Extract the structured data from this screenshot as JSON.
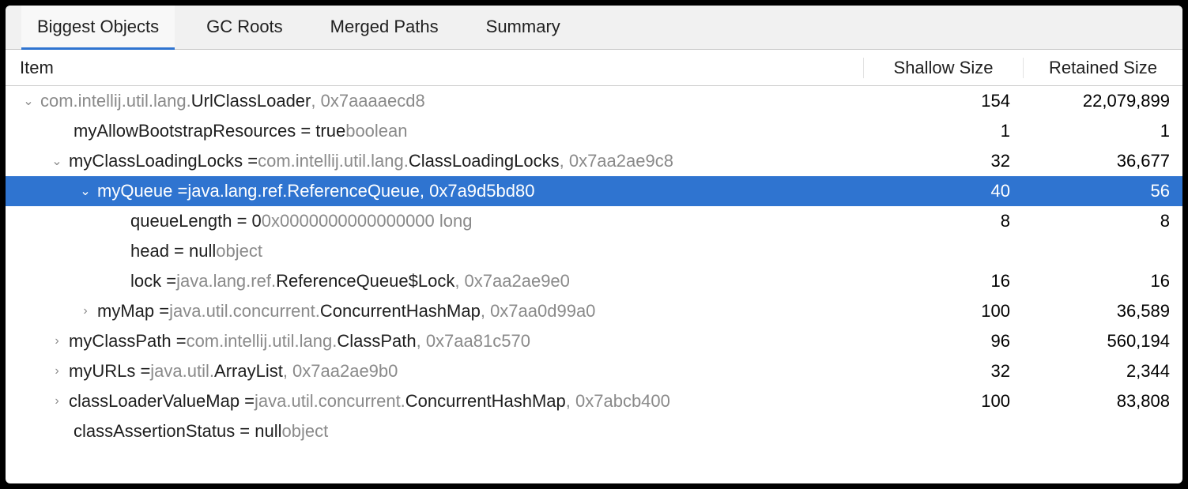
{
  "tabs": [
    {
      "label": "Biggest Objects",
      "active": true
    },
    {
      "label": "GC Roots",
      "active": false
    },
    {
      "label": "Merged Paths",
      "active": false
    },
    {
      "label": "Summary",
      "active": false
    }
  ],
  "columns": {
    "item": "Item",
    "shallow": "Shallow Size",
    "retained": "Retained Size"
  },
  "rows": [
    {
      "indent": 0,
      "chev": "down",
      "selected": false,
      "segments": [
        {
          "t": "com.intellij.util.lang.",
          "c": "pkg"
        },
        {
          "t": "UrlClassLoader",
          "c": "cls"
        },
        {
          "t": ", 0x7aaaaecd8",
          "c": "addr"
        }
      ],
      "shallow": "154",
      "retained": "22,079,899"
    },
    {
      "indent": 1,
      "chev": "",
      "selected": false,
      "segments": [
        {
          "t": "myAllowBootstrapResources = true ",
          "c": "field"
        },
        {
          "t": "boolean",
          "c": "typ"
        }
      ],
      "shallow": "1",
      "retained": "1"
    },
    {
      "indent": 1,
      "chev": "down",
      "selected": false,
      "segments": [
        {
          "t": "myClassLoadingLocks = ",
          "c": "field"
        },
        {
          "t": "com.intellij.util.lang.",
          "c": "pkg"
        },
        {
          "t": "ClassLoadingLocks",
          "c": "cls"
        },
        {
          "t": ", 0x7aa2ae9c8",
          "c": "addr"
        }
      ],
      "shallow": "32",
      "retained": "36,677"
    },
    {
      "indent": 2,
      "chev": "down",
      "selected": true,
      "segments": [
        {
          "t": "myQueue = ",
          "c": "field"
        },
        {
          "t": "java.lang.ref.",
          "c": "pkg"
        },
        {
          "t": "ReferenceQueue",
          "c": "cls"
        },
        {
          "t": ", 0x7a9d5bd80",
          "c": "addr"
        }
      ],
      "shallow": "40",
      "retained": "56"
    },
    {
      "indent": 3,
      "chev": "",
      "selected": false,
      "segments": [
        {
          "t": "queueLength = 0 ",
          "c": "field"
        },
        {
          "t": "0x0000000000000000  long",
          "c": "addr"
        }
      ],
      "shallow": "8",
      "retained": "8"
    },
    {
      "indent": 3,
      "chev": "",
      "selected": false,
      "segments": [
        {
          "t": "head = null ",
          "c": "field"
        },
        {
          "t": "object",
          "c": "typ"
        }
      ],
      "shallow": "",
      "retained": ""
    },
    {
      "indent": 3,
      "chev": "",
      "selected": false,
      "segments": [
        {
          "t": "lock = ",
          "c": "field"
        },
        {
          "t": "java.lang.ref.",
          "c": "pkg"
        },
        {
          "t": "ReferenceQueue$Lock",
          "c": "cls"
        },
        {
          "t": ", 0x7aa2ae9e0",
          "c": "addr"
        }
      ],
      "shallow": "16",
      "retained": "16"
    },
    {
      "indent": 2,
      "chev": "right",
      "selected": false,
      "segments": [
        {
          "t": "myMap = ",
          "c": "field"
        },
        {
          "t": "java.util.concurrent.",
          "c": "pkg"
        },
        {
          "t": "ConcurrentHashMap",
          "c": "cls"
        },
        {
          "t": ", 0x7aa0d99a0",
          "c": "addr"
        }
      ],
      "shallow": "100",
      "retained": "36,589"
    },
    {
      "indent": 1,
      "chev": "right",
      "selected": false,
      "segments": [
        {
          "t": "myClassPath = ",
          "c": "field"
        },
        {
          "t": "com.intellij.util.lang.",
          "c": "pkg"
        },
        {
          "t": "ClassPath",
          "c": "cls"
        },
        {
          "t": ", 0x7aa81c570",
          "c": "addr"
        }
      ],
      "shallow": "96",
      "retained": "560,194"
    },
    {
      "indent": 1,
      "chev": "right",
      "selected": false,
      "segments": [
        {
          "t": "myURLs = ",
          "c": "field"
        },
        {
          "t": "java.util.",
          "c": "pkg"
        },
        {
          "t": "ArrayList",
          "c": "cls"
        },
        {
          "t": ", 0x7aa2ae9b0",
          "c": "addr"
        }
      ],
      "shallow": "32",
      "retained": "2,344"
    },
    {
      "indent": 1,
      "chev": "right",
      "selected": false,
      "segments": [
        {
          "t": "classLoaderValueMap = ",
          "c": "field"
        },
        {
          "t": "java.util.concurrent.",
          "c": "pkg"
        },
        {
          "t": "ConcurrentHashMap",
          "c": "cls"
        },
        {
          "t": ", 0x7abcb400",
          "c": "addr"
        }
      ],
      "shallow": "100",
      "retained": "83,808"
    },
    {
      "indent": 1,
      "chev": "",
      "selected": false,
      "segments": [
        {
          "t": "classAssertionStatus = null ",
          "c": "field"
        },
        {
          "t": "object",
          "c": "typ"
        }
      ],
      "shallow": "",
      "retained": ""
    }
  ]
}
